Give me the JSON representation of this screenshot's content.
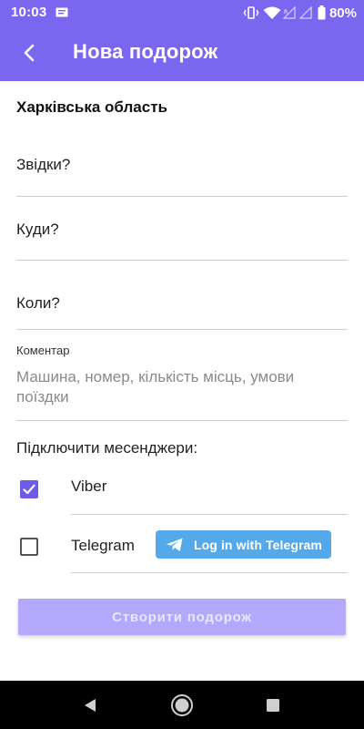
{
  "status_bar": {
    "time": "10:03",
    "battery": "80%",
    "icons": [
      "message-icon",
      "vibrate-icon",
      "wifi-icon",
      "signal-icon",
      "signal-icon",
      "battery-icon"
    ]
  },
  "app_bar": {
    "title": "Нова подорож",
    "back_icon": "arrow-back-icon"
  },
  "form": {
    "region": "Харківська область",
    "from_label": "Звідки?",
    "to_label": "Куди?",
    "when_label": "Коли?",
    "comment_label": "Коментар",
    "comment_placeholder": "Машина, номер, кількість місць, умови поїздки"
  },
  "messengers": {
    "title": "Підключити месенджери:",
    "items": [
      {
        "name": "Viber",
        "checked": true
      },
      {
        "name": "Telegram",
        "checked": false,
        "login_button": "Log in with Telegram"
      }
    ]
  },
  "actions": {
    "create_label": "Створити подорож"
  },
  "colors": {
    "primary": "#7B66F0",
    "checkbox": "#6f5ce6",
    "telegram": "#54A9EB",
    "create_button_disabled": "#b3a8fb"
  }
}
